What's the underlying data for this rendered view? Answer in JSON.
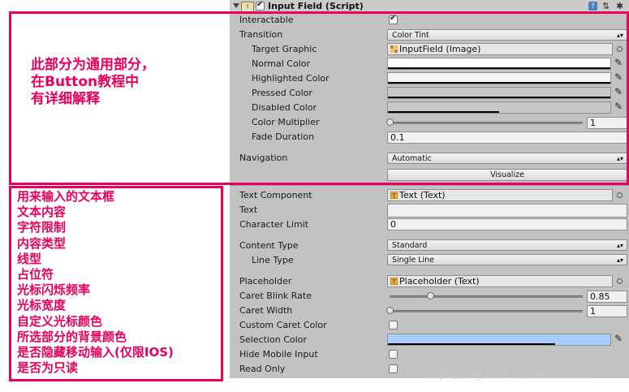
{
  "header": {
    "component_checked": true,
    "title": "Input Field (Script)",
    "help_icon": "help-icon",
    "preset_icon": "preset-icon",
    "gear_icon": "gear-icon"
  },
  "interactable": {
    "label": "Interactable",
    "checked": true
  },
  "transition": {
    "label": "Transition",
    "value": "Color Tint"
  },
  "target_graphic": {
    "label": "Target Graphic",
    "value": "InputField (Image)"
  },
  "colors": {
    "normal": {
      "label": "Normal Color",
      "hex": "#ffffff",
      "alpha": 1.0
    },
    "highlighted": {
      "label": "Highlighted Color",
      "hex": "#f5f5f5",
      "alpha": 1.0
    },
    "pressed": {
      "label": "Pressed Color",
      "hex": "#c8c8c8",
      "alpha": 1.0
    },
    "disabled": {
      "label": "Disabled Color",
      "hex": "#c8c8c8",
      "alpha": 0.5
    }
  },
  "color_multiplier": {
    "label": "Color Multiplier",
    "value": "1",
    "fraction": 0.0
  },
  "fade_duration": {
    "label": "Fade Duration",
    "value": "0.1"
  },
  "navigation": {
    "label": "Navigation",
    "value": "Automatic",
    "visualize_label": "Visualize"
  },
  "text_component": {
    "label": "Text Component",
    "value": "Text (Text)"
  },
  "text": {
    "label": "Text",
    "value": ""
  },
  "character_limit": {
    "label": "Character Limit",
    "value": "0"
  },
  "content_type": {
    "label": "Content Type",
    "value": "Standard"
  },
  "line_type": {
    "label": "Line Type",
    "value": "Single Line"
  },
  "placeholder": {
    "label": "Placeholder",
    "value": "Placeholder (Text)"
  },
  "caret_blink_rate": {
    "label": "Caret Blink Rate",
    "value": "0.85",
    "fraction": 0.21
  },
  "caret_width": {
    "label": "Caret Width",
    "value": "1",
    "fraction": 0.0
  },
  "custom_caret_color": {
    "label": "Custom Caret Color",
    "checked": false
  },
  "selection_color": {
    "label": "Selection Color",
    "hex": "#a8cefF",
    "alpha": 0.75
  },
  "hide_mobile_input": {
    "label": "Hide Mobile Input",
    "checked": false
  },
  "read_only": {
    "label": "Read Only",
    "checked": false
  },
  "annotation_top": {
    "lines": [
      "此部分为通用部分，",
      "在Button教程中",
      "有详细解释"
    ]
  },
  "annotation_bottom": {
    "lines": [
      "用来输入的文本框",
      "文本内容",
      "字符限制",
      "内容类型",
      "线型",
      "占位符",
      "光标闪烁频率",
      "光标宽度",
      "自定义光标颜色",
      "所选部分的背景颜色",
      "是否隐藏移动输入(仅限IOS)",
      "是否为只读"
    ]
  },
  "watermark": "https://blog.csdn.net/ChinarCSDN",
  "accent_color": "#e8005d"
}
